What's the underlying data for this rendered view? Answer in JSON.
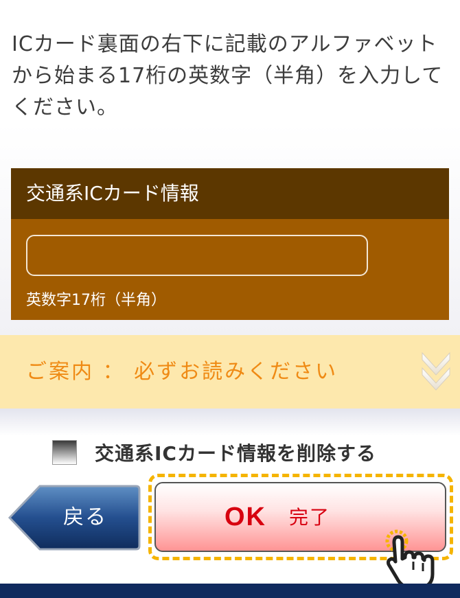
{
  "instruction": "ICカード裏面の右下に記載のアルファベットから始まる17桁の英数字（半角）を入力してください。",
  "card_panel": {
    "title": "交通系ICカード情報",
    "input_value": "",
    "input_placeholder": "",
    "hint": "英数字17桁（半角）"
  },
  "notice": {
    "text": "ご案内 ： 必ずお読みください",
    "icon": "double-chevron-down-icon"
  },
  "delete_option": {
    "label": "交通系ICカード情報を削除する",
    "checked": false
  },
  "buttons": {
    "back_label": "戻る",
    "ok_label": "OK",
    "ok_sublabel": "完了"
  },
  "colors": {
    "card_header": "#5c3700",
    "card_body": "#a05b00",
    "notice_bg": "#fde8ad",
    "notice_text": "#ef8a14",
    "ok_text": "#d7000f",
    "highlight_outline": "#f5b400",
    "back_button": "#1b3d74",
    "footer": "#102a5e"
  }
}
